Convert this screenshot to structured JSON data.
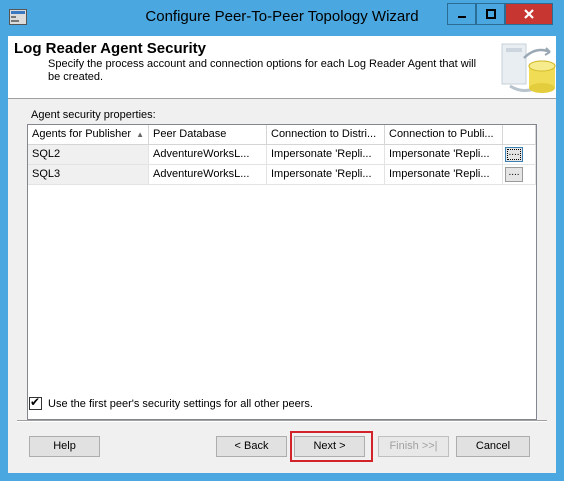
{
  "window": {
    "title": "Configure Peer-To-Peer Topology Wizard",
    "accent_color": "#4aa7df",
    "close_color": "#c73630",
    "icons": {
      "app": "wizard-app-icon",
      "minimize": "minimize-icon",
      "maximize": "maximize-icon",
      "close": "close-icon"
    }
  },
  "header": {
    "title": "Log Reader Agent Security",
    "description": "Specify the process account and connection options for each Log Reader Agent that will be created.",
    "graphic": "database-sync-icon"
  },
  "section": {
    "label": "Agent security properties:"
  },
  "grid": {
    "columns": [
      "Agents for Publisher",
      "Peer Database",
      "Connection to Distri...",
      "Connection to Publi...",
      ""
    ],
    "sort_indicator": "▲",
    "rows": [
      {
        "publisher": "SQL2",
        "database": "AdventureWorksL...",
        "distributor": "Impersonate 'Repli...",
        "publisher_conn": "Impersonate 'Repli...",
        "action": "...."
      },
      {
        "publisher": "SQL3",
        "database": "AdventureWorksL...",
        "distributor": "Impersonate 'Repli...",
        "publisher_conn": "Impersonate 'Repli...",
        "action": "...."
      }
    ]
  },
  "options": {
    "use_first_peer_label": "Use the first peer's security settings for all other peers.",
    "use_first_peer_checked": true
  },
  "buttons": {
    "help": "Help",
    "back": "< Back",
    "next": "Next >",
    "finish": "Finish >>|",
    "cancel": "Cancel"
  },
  "highlight_color": "#d2232a"
}
